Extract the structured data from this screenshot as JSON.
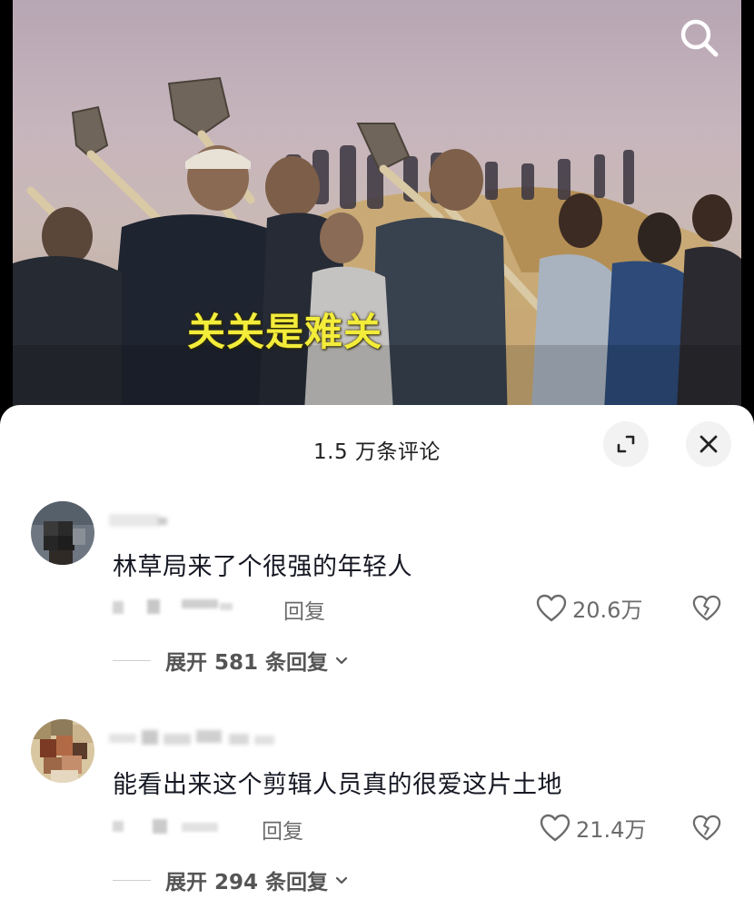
{
  "video": {
    "caption": "关关是难关",
    "search_icon": "search-icon"
  },
  "sheet": {
    "title": "1.5 万条评论",
    "expand_icon": "expand-icon",
    "close_icon": "close-icon"
  },
  "comments": [
    {
      "text": "林草局来了个很强的年轻人",
      "reply_label": "回复",
      "likes": "20.6万",
      "expand_label": "展开 581 条回复"
    },
    {
      "text": "能看出来这个剪辑人员真的很爱这片土地",
      "reply_label": "回复",
      "likes": "21.4万",
      "expand_label": "展开 294 条回复"
    }
  ],
  "colors": {
    "caption": "#f3ec3a",
    "sheet_bg": "#ffffff",
    "text_primary": "#161823",
    "text_secondary": "#6b6b6b"
  }
}
